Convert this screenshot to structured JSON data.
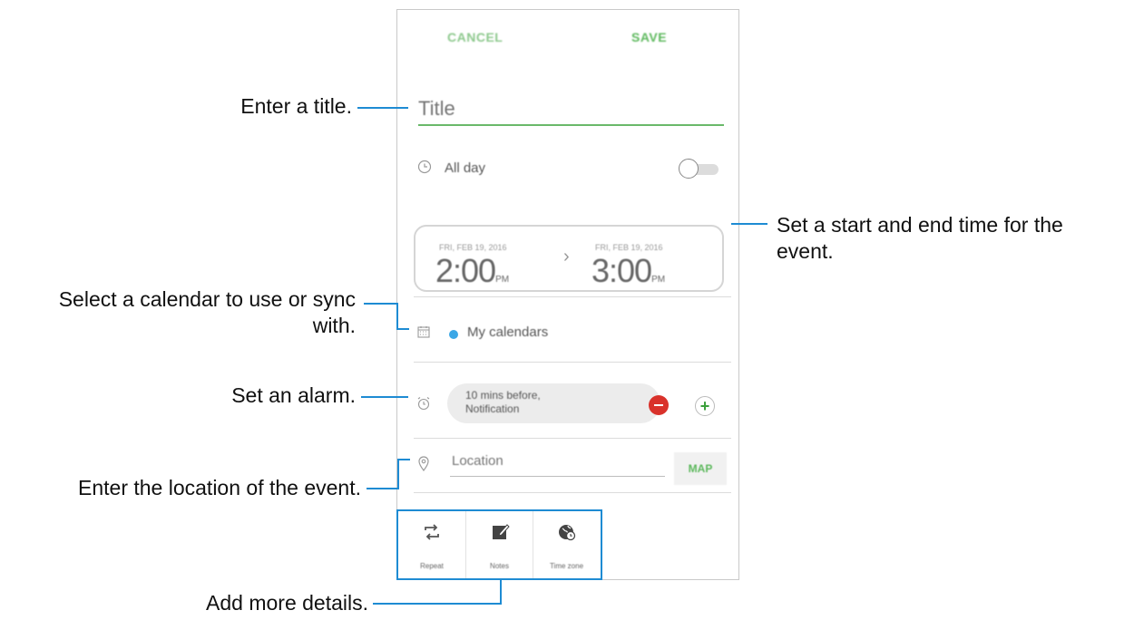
{
  "phone": {
    "cancel_label": "CANCEL",
    "save_label": "SAVE",
    "title_placeholder": "Title",
    "allday_label": "All day",
    "start_date": "FRI, FEB 19, 2016",
    "start_time": "2:00",
    "start_ampm": "PM",
    "end_date": "FRI, FEB 19, 2016",
    "end_time": "3:00",
    "end_ampm": "PM",
    "calendar_label": "My calendars",
    "alarm_line1": "10 mins before,",
    "alarm_line2": "Notification",
    "location_placeholder": "Location",
    "map_label": "MAP",
    "details": [
      {
        "label": "Repeat",
        "icon": "repeat-icon"
      },
      {
        "label": "Notes",
        "icon": "notes-icon"
      },
      {
        "label": "Time zone",
        "icon": "time-zone-icon"
      }
    ]
  },
  "callouts": {
    "title": "Enter a title.",
    "time_line1": "Set a start and end time for the",
    "time_line2": "event.",
    "calendar_line1": "Select a calendar to use or sync",
    "calendar_line2": "with.",
    "alarm": "Set an alarm.",
    "location": "Enter the location of the event.",
    "details": "Add more details."
  },
  "colors": {
    "accent_green": "#5cb85c",
    "callout_blue": "#1e8bd3",
    "calendar_dot": "#3ba7e6",
    "remove_red": "#d9322b"
  }
}
